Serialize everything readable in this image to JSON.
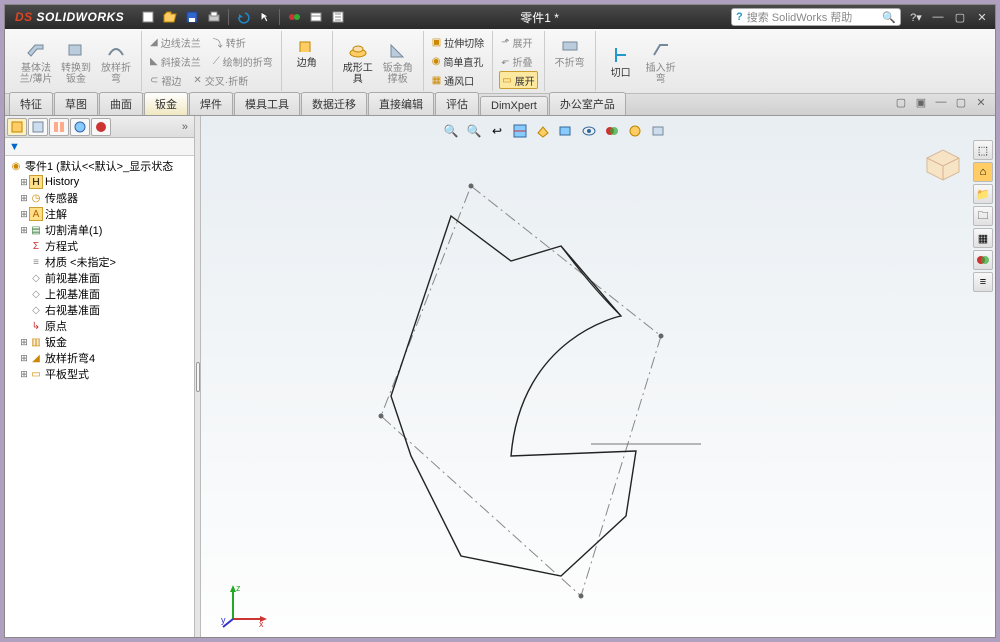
{
  "titlebar": {
    "logo_prefix": "DS",
    "logo_text": "SOLIDWORKS",
    "doc_title": "零件1 *",
    "search_placeholder": "搜索 SolidWorks 帮助"
  },
  "ribbon": {
    "g1": {
      "b1": "基体法\n兰/薄片",
      "b2": "转换到\n钣金",
      "b3": "放样折\n弯"
    },
    "g2": {
      "r1": "边线法兰",
      "r2": "斜接法兰",
      "r3": "褶边",
      "r4": "转折",
      "r5": "绘制的折弯",
      "r6": "交叉·折断"
    },
    "g3": {
      "b1": "边角"
    },
    "g4": {
      "b1": "成形工\n具",
      "b2": "钣金角\n撑板"
    },
    "g5": {
      "r1": "拉伸切除",
      "r2": "简单直孔",
      "r3": "通风口"
    },
    "g6": {
      "r1": "展开",
      "r2": "折叠",
      "r3": "展开"
    },
    "g7": {
      "b1": "不折弯"
    },
    "g8": {
      "b1": "切口",
      "b2": "插入折\n弯"
    }
  },
  "tabs": [
    "特征",
    "草图",
    "曲面",
    "钣金",
    "焊件",
    "模具工具",
    "数据迁移",
    "直接编辑",
    "评估",
    "DimXpert",
    "办公室产品"
  ],
  "active_tab_index": 3,
  "tree": {
    "root": "零件1 (默认<<默认>_显示状态",
    "items": [
      {
        "icon": "history",
        "label": "History",
        "twist": "+"
      },
      {
        "icon": "sensor",
        "label": "传感器",
        "twist": "+"
      },
      {
        "icon": "annot",
        "label": "注解",
        "twist": "+"
      },
      {
        "icon": "cutlist",
        "label": "切割清单(1)",
        "twist": "+"
      },
      {
        "icon": "eq",
        "label": "方程式",
        "twist": ""
      },
      {
        "icon": "mat",
        "label": "材质 <未指定>",
        "twist": ""
      },
      {
        "icon": "plane",
        "label": "前视基准面",
        "twist": ""
      },
      {
        "icon": "plane",
        "label": "上视基准面",
        "twist": ""
      },
      {
        "icon": "plane",
        "label": "右视基准面",
        "twist": ""
      },
      {
        "icon": "origin",
        "label": "原点",
        "twist": ""
      },
      {
        "icon": "sm",
        "label": "钣金",
        "twist": "+"
      },
      {
        "icon": "loft",
        "label": "放样折弯4",
        "twist": "+"
      },
      {
        "icon": "flat",
        "label": "平板型式",
        "twist": "+"
      }
    ]
  },
  "triad": {
    "x": "x",
    "y": "y",
    "z": "z"
  }
}
